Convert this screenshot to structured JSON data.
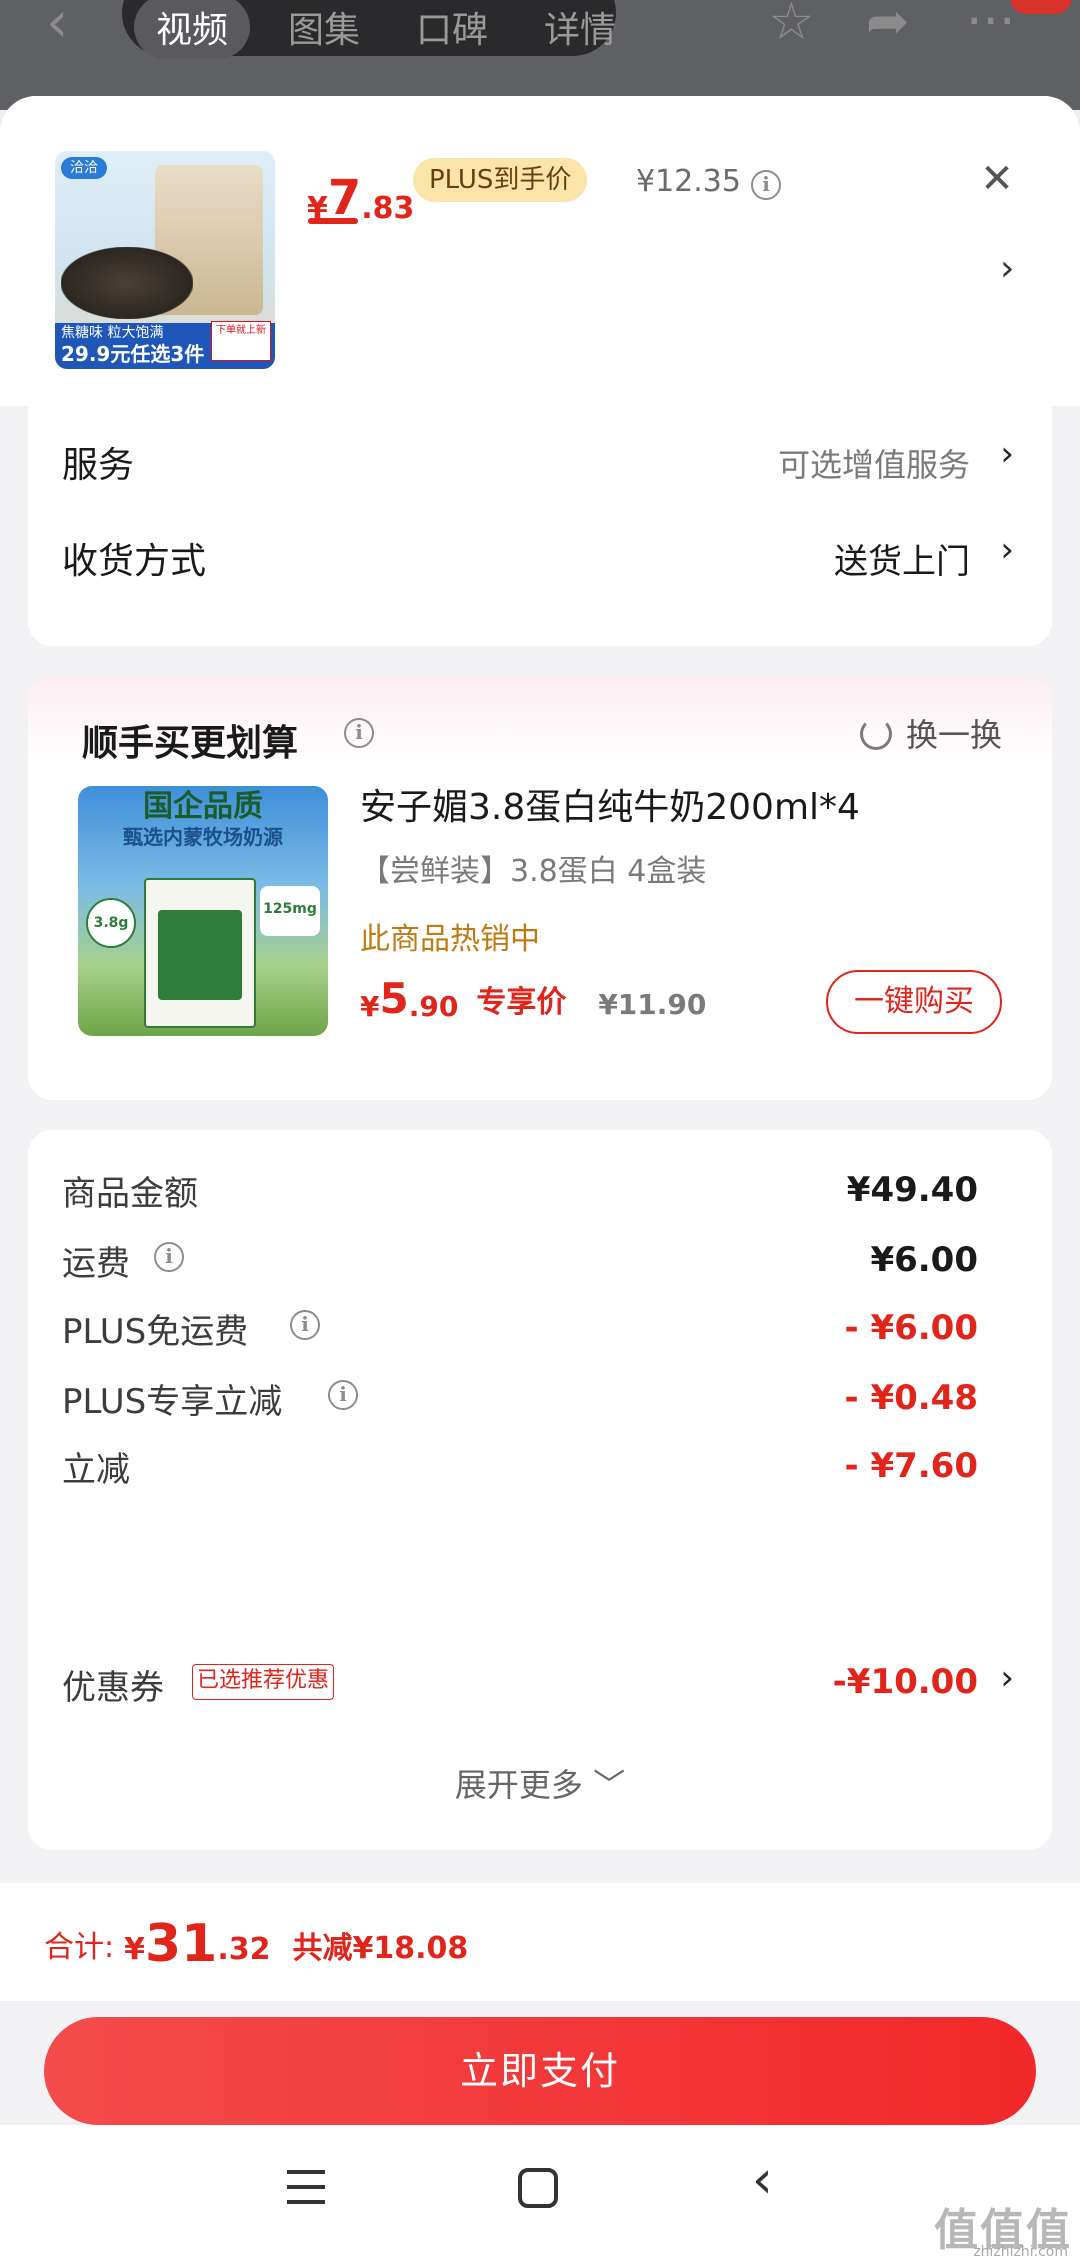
{
  "top_bar": {
    "tabs": [
      "视频",
      "图集",
      "口碑",
      "详情"
    ],
    "back_glyph": "‹",
    "icons": [
      "star-icon",
      "share-icon",
      "more-icon"
    ]
  },
  "product": {
    "thumb_logo": "洽洽",
    "thumb_strip_small": "焦糖味 粒大饱满",
    "thumb_strip": "29.9元任选3件",
    "thumb_sticker": "下单就上新",
    "price_currency": "¥",
    "price_int": "7",
    "price_dec": ".83",
    "plus_tag": "PLUS到手价",
    "original_price": "¥12.35"
  },
  "service": {
    "label": "服务",
    "value": "可选增值服务",
    "chevron": "›"
  },
  "delivery": {
    "label": "收货方式",
    "value": "送货上门",
    "chevron": "›"
  },
  "bundle": {
    "title": "顺手买更划算",
    "swap_label": "换一换",
    "image_banner": "国企品质",
    "image_banner_sub": "甄选内蒙牧场奶源",
    "image_badge": "3.8g",
    "image_badge2": "125mg",
    "name": "安子媚3.8蛋白纯牛奶200ml*4",
    "spec": "【尝鲜装】3.8蛋白 4盒装",
    "hot_text": "此商品热销中",
    "price_currency": "¥",
    "price_int": "5",
    "price_dec": ".90",
    "exclusive_label": "专享价",
    "original_price": "¥11.90",
    "buy_button": "一键购买"
  },
  "costs": [
    {
      "label": "商品金额",
      "value": "¥49.40"
    },
    {
      "label": "运费",
      "value": "¥6.00"
    },
    {
      "label": "PLUS免运费",
      "value": "- ¥6.00"
    },
    {
      "label": "PLUS专享立减",
      "value": "- ¥0.48"
    },
    {
      "label": "立减",
      "value": "- ¥7.60"
    },
    {
      "label": "优惠券",
      "value": "-¥10.00"
    }
  ],
  "coupon_tag": "已选推荐优惠",
  "expand_more": "展开更多 ﹀",
  "footer": {
    "total_label": "合计:",
    "total_currency": "¥",
    "total_int": "31",
    "total_dec": ".32",
    "total_saved": "共减¥18.08",
    "pay_button": "立即支付"
  },
  "watermark": "值值值",
  "watermark_sub": "zhizhizhi.com",
  "colors": {
    "accent_red": "#e1251b",
    "plus_gold": "#fbe4a8",
    "hot_orange": "#c07a12"
  }
}
